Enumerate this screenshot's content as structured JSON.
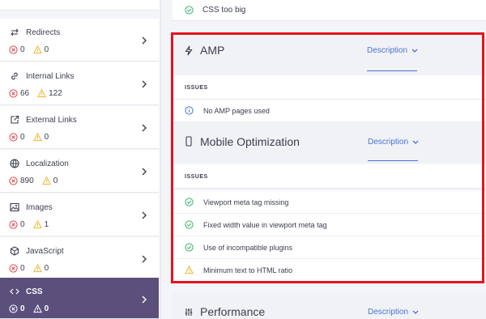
{
  "sidebar": {
    "items": [
      {
        "label": "Redirects",
        "icon": "redirect-icon",
        "errors": "0",
        "warnings": "0"
      },
      {
        "label": "Internal Links",
        "icon": "link-icon",
        "errors": "66",
        "warnings": "122"
      },
      {
        "label": "External Links",
        "icon": "external-link-icon",
        "errors": "0",
        "warnings": "0"
      },
      {
        "label": "Localization",
        "icon": "globe-icon",
        "errors": "890",
        "warnings": "0"
      },
      {
        "label": "Images",
        "icon": "image-icon",
        "errors": "0",
        "warnings": "1"
      },
      {
        "label": "JavaScript",
        "icon": "javascript-icon",
        "errors": "0",
        "warnings": "0"
      },
      {
        "label": "CSS",
        "icon": "code-icon",
        "errors": "0",
        "warnings": "0",
        "active": true
      }
    ]
  },
  "main": {
    "top_issue": "CSS too big",
    "amp": {
      "title": "AMP",
      "description_label": "Description",
      "issues_label": "ISSUES",
      "issues": [
        {
          "text": "No AMP pages used",
          "status": "info"
        }
      ]
    },
    "mobile": {
      "title": "Mobile Optimization",
      "description_label": "Description",
      "issues_label": "ISSUES",
      "issues": [
        {
          "text": "Viewport meta tag missing",
          "status": "ok"
        },
        {
          "text": "Fixed width value in viewport meta tag",
          "status": "ok"
        },
        {
          "text": "Use of incompatible plugins",
          "status": "ok"
        },
        {
          "text": "Minimum text to HTML ratio",
          "status": "warning"
        }
      ]
    },
    "performance": {
      "title": "Performance",
      "description_label": "Description"
    }
  },
  "colors": {
    "accent": "#4a72d4",
    "ok": "#3ab26a",
    "warning": "#f2b632",
    "error": "#e0474c",
    "info": "#4a72d4",
    "active_sidebar": "#5b4f7c",
    "highlight": "#e8121f"
  }
}
